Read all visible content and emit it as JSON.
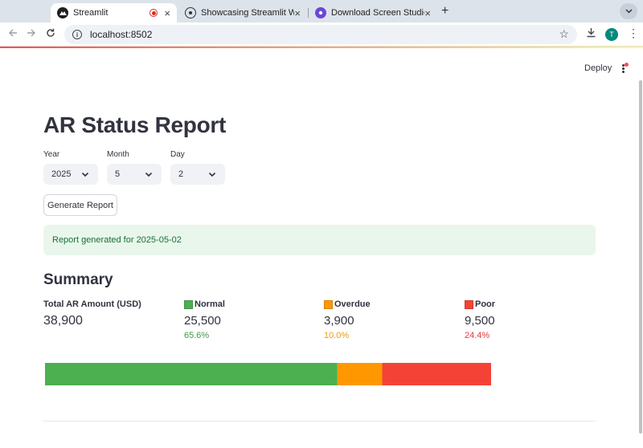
{
  "browser": {
    "tabs": [
      {
        "title": "Streamlit",
        "active": true,
        "recording": true
      },
      {
        "title": "Showcasing Streamlit Work",
        "active": false
      },
      {
        "title": "Download Screen Studio for",
        "active": false
      }
    ],
    "address": "localhost:8502",
    "profile_initial": "T"
  },
  "app": {
    "deploy_label": "Deploy",
    "title": "AR Status Report",
    "filters": {
      "year": {
        "label": "Year",
        "value": "2025"
      },
      "month": {
        "label": "Month",
        "value": "5"
      },
      "day": {
        "label": "Day",
        "value": "2"
      }
    },
    "generate_button": "Generate Report",
    "success_message": "Report generated for 2025-05-02",
    "summary_header": "Summary",
    "metrics": {
      "total": {
        "label": "Total AR Amount (USD)",
        "value": "38,900"
      },
      "normal": {
        "icon": "green-square-icon",
        "label": "Normal",
        "value": "25,500",
        "pct": "65.6%",
        "color": "#4caf50",
        "delta_color": "#3e9b46"
      },
      "overdue": {
        "icon": "orange-square-icon",
        "label": "Overdue",
        "value": "3,900",
        "pct": "10.0%",
        "color": "#ff9800",
        "delta_color": "#f29b0a"
      },
      "poor": {
        "icon": "red-square-icon",
        "label": "Poor",
        "value": "9,500",
        "pct": "24.4%",
        "color": "#f44336",
        "delta_color": "#e53935"
      }
    }
  },
  "chart_data": {
    "type": "bar",
    "orientation": "horizontal-stacked",
    "series": [
      {
        "name": "Normal",
        "values": [
          25500
        ],
        "color": "#4caf50"
      },
      {
        "name": "Overdue",
        "values": [
          3900
        ],
        "color": "#ff9800"
      },
      {
        "name": "Poor",
        "values": [
          9500
        ],
        "color": "#f44336"
      }
    ],
    "xlim": [
      0,
      38900
    ],
    "grid": false,
    "axes": false
  }
}
